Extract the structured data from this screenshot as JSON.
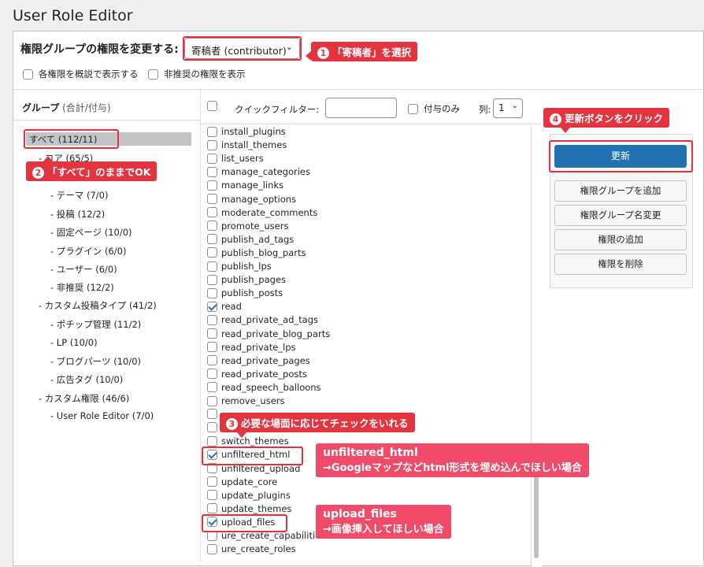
{
  "page": {
    "title": "User Role Editor"
  },
  "role": {
    "label": "権限グループの権限を変更する:",
    "selected": "寄稿者 (contributor)"
  },
  "options": {
    "show_readable": "各権限を概説で表示する",
    "show_deprecated": "非推奨の権限を表示"
  },
  "groups": {
    "header_main": "グループ",
    "header_sub": "(合計/付与)",
    "items": [
      "すべて (112/11)",
      "- コア (65/5)",
      "- テーマ (7/0)",
      "- 投稿 (12/2)",
      "- 固定ページ (10/0)",
      "- プラグイン (6/0)",
      "- ユーザー (6/0)",
      "- 非推奨 (12/2)",
      "- カスタム投稿タイプ (41/2)",
      "- ポチップ管理 (11/2)",
      "- LP (10/0)",
      "- ブログパーツ (10/0)",
      "- 広告タグ (10/0)",
      "- カスタム権限 (46/6)",
      "- User Role Editor (7/0)"
    ]
  },
  "filter": {
    "quick_label": "クイックフィルター:",
    "granted_only": "付与のみ",
    "columns_label": "列:",
    "columns_value": "1"
  },
  "capabilities": [
    {
      "name": "install_plugins",
      "checked": false
    },
    {
      "name": "install_themes",
      "checked": false
    },
    {
      "name": "list_users",
      "checked": false
    },
    {
      "name": "manage_categories",
      "checked": false
    },
    {
      "name": "manage_links",
      "checked": false
    },
    {
      "name": "manage_options",
      "checked": false
    },
    {
      "name": "moderate_comments",
      "checked": false
    },
    {
      "name": "promote_users",
      "checked": false
    },
    {
      "name": "publish_ad_tags",
      "checked": false
    },
    {
      "name": "publish_blog_parts",
      "checked": false
    },
    {
      "name": "publish_lps",
      "checked": false
    },
    {
      "name": "publish_pages",
      "checked": false
    },
    {
      "name": "publish_posts",
      "checked": false
    },
    {
      "name": "read",
      "checked": true
    },
    {
      "name": "read_private_ad_tags",
      "checked": false
    },
    {
      "name": "read_private_blog_parts",
      "checked": false
    },
    {
      "name": "read_private_lps",
      "checked": false
    },
    {
      "name": "read_private_pages",
      "checked": false
    },
    {
      "name": "read_private_posts",
      "checked": false
    },
    {
      "name": "read_speech_balloons",
      "checked": false
    },
    {
      "name": "remove_users",
      "checked": false
    },
    {
      "name": "",
      "checked": false
    },
    {
      "name": "",
      "checked": false
    },
    {
      "name": "switch_themes",
      "checked": false
    },
    {
      "name": "unfiltered_html",
      "checked": true
    },
    {
      "name": "unfiltered_upload",
      "checked": false
    },
    {
      "name": "update_core",
      "checked": false
    },
    {
      "name": "update_plugins",
      "checked": false
    },
    {
      "name": "update_themes",
      "checked": false
    },
    {
      "name": "upload_files",
      "checked": true
    },
    {
      "name": "ure_create_capabilities",
      "checked": false
    },
    {
      "name": "ure_create_roles",
      "checked": false
    }
  ],
  "actions": {
    "update": "更新",
    "add_role": "権限グループを追加",
    "rename_role": "権限グループ名変更",
    "add_capability": "権限の追加",
    "delete_capability": "権限を削除"
  },
  "annotations": {
    "step1": {
      "num": "1",
      "text": "「寄稿者」を選択"
    },
    "step2": {
      "num": "2",
      "text": "「すべて」のままでOK"
    },
    "step3": {
      "num": "3",
      "text": "必要な場面に応じてチェックをいれる"
    },
    "step4": {
      "num": "4",
      "text": "更新ボタンをクリック"
    },
    "note_unfiltered": {
      "line1": "unfiltered_html",
      "line2": "→Googleマップなどhtml形式を埋め込んでほしい場合"
    },
    "note_upload": {
      "line1": "upload_files",
      "line2": "→画像挿入してほしい場合"
    }
  },
  "colors": {
    "primary_button": "#2271b1",
    "annotation_red": "#e3343f",
    "annotation_pink": "#f24b6a"
  }
}
